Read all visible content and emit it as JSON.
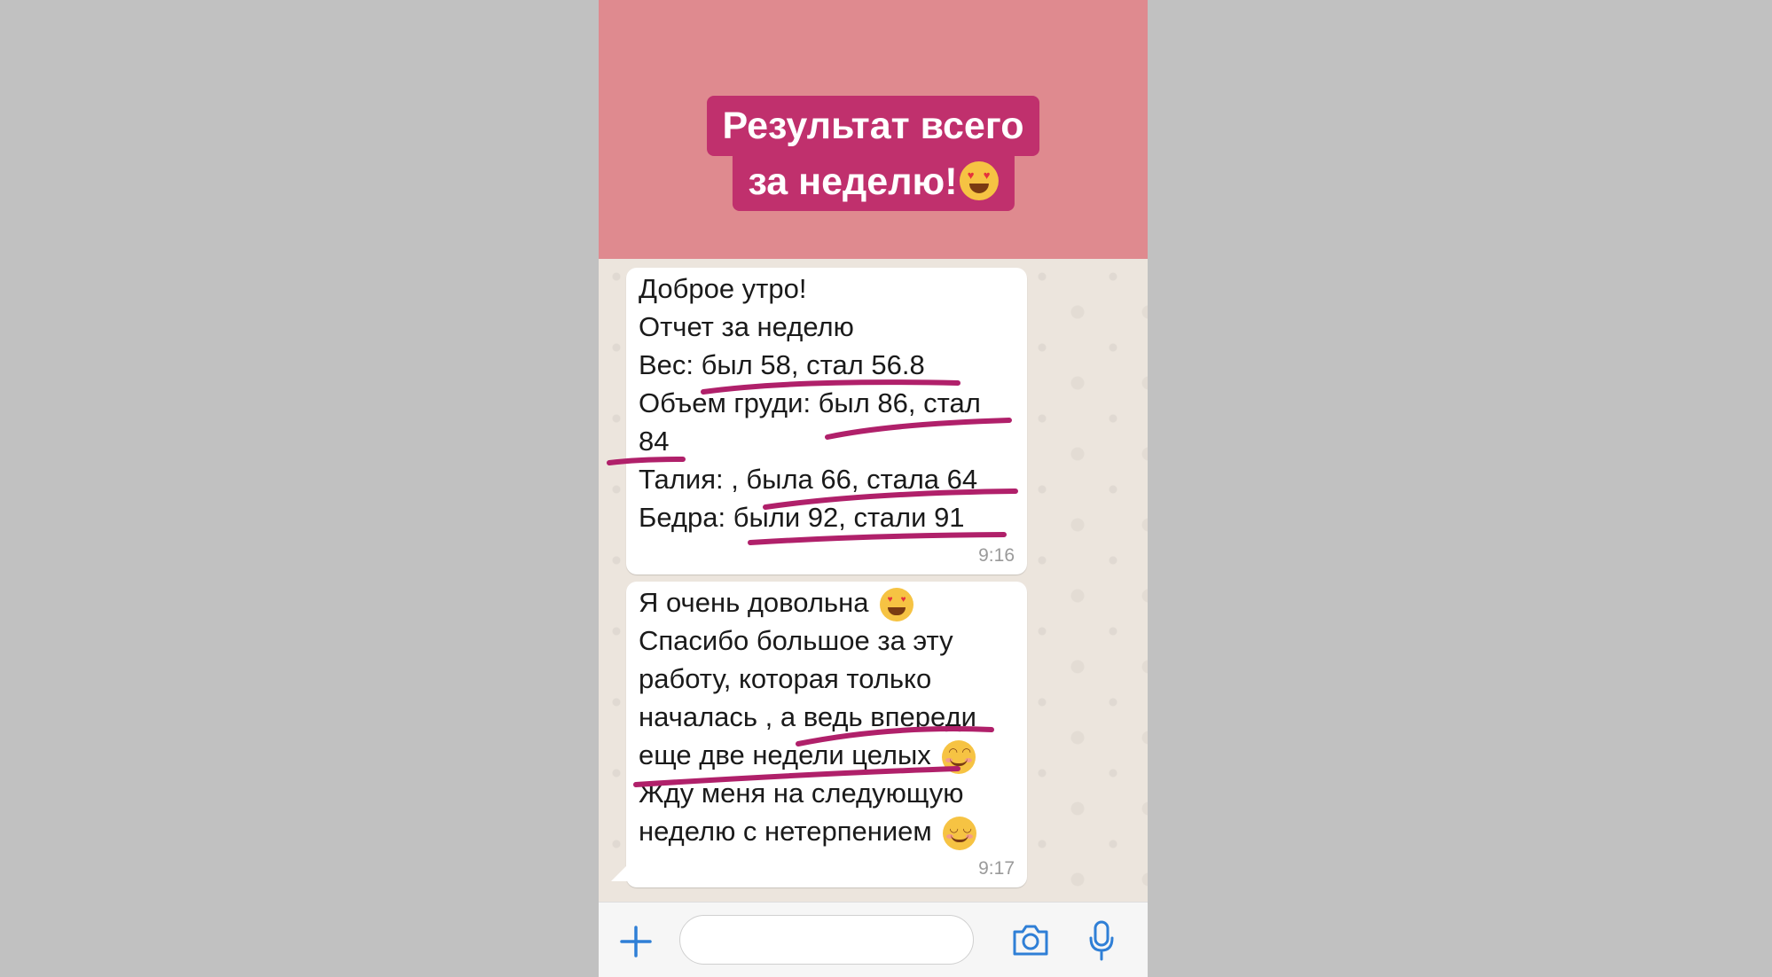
{
  "banner": {
    "line1": "Результат всего",
    "line2": "за неделю!",
    "emoji": "heart-eyes"
  },
  "messages": [
    {
      "lines": [
        "Доброе утро!",
        "Отчет за неделю",
        "Вес: был 58, стал 56.8",
        "Объем груди: был 86, стал",
        "84",
        "Талия: , была 66, стала 64",
        "Бедра: были 92, стали 91"
      ],
      "time": "9:16"
    },
    {
      "lines": [
        "Я очень довольна",
        "Спасибо большое за эту",
        "работу,  которая только",
        "началась , а ведь впереди",
        "еще две недели целых",
        "Жду меня на следующую",
        "неделю с нетерпением"
      ],
      "emojis": [
        "heart-eyes",
        "smiling-face",
        "relieved-face"
      ],
      "time": "9:17"
    }
  ],
  "input_bar": {
    "icons": [
      "plus-icon",
      "camera-icon",
      "microphone-icon"
    ],
    "accent": "#2f7fd6"
  },
  "colors": {
    "banner_bg": "#df8a8f",
    "banner_label": "#c0306d",
    "highlight": "#b0206a"
  }
}
